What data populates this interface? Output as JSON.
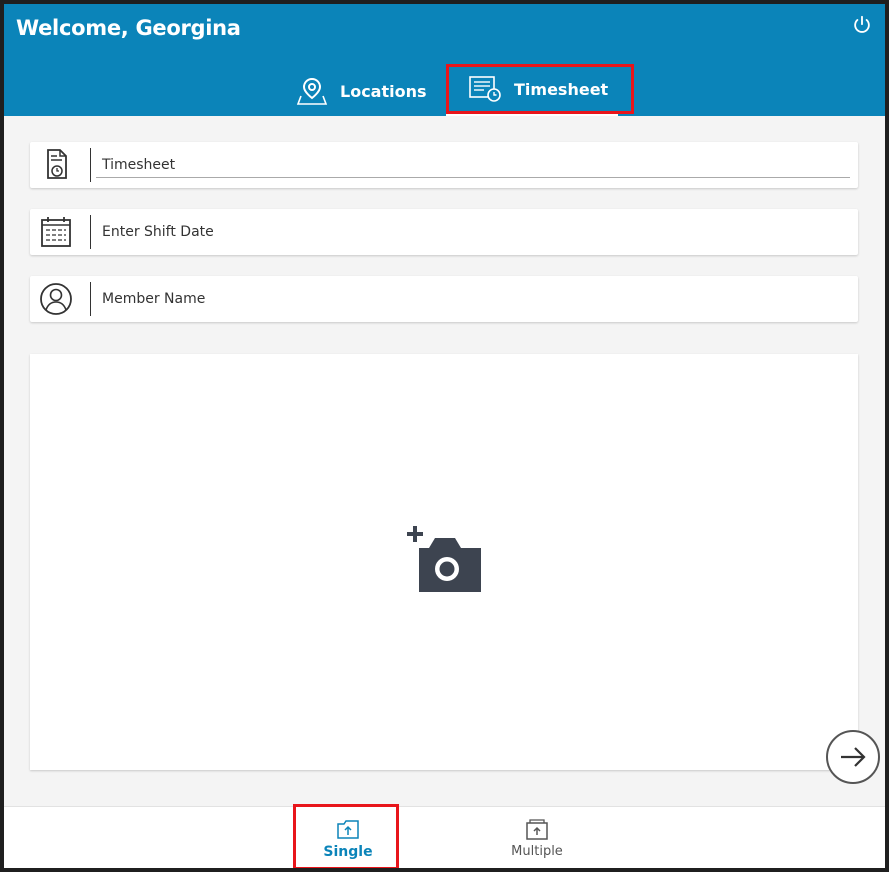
{
  "header": {
    "welcome": "Welcome, Georgina",
    "power_icon": "power-icon",
    "tabs": [
      {
        "label": "Locations",
        "icon": "map-pin-icon",
        "active": false
      },
      {
        "label": "Timesheet",
        "icon": "timesheet-icon",
        "active": true
      }
    ]
  },
  "form": {
    "timesheet": {
      "placeholder": "Timesheet",
      "icon": "document-clock-icon"
    },
    "shift_date": {
      "placeholder": "Enter Shift Date",
      "icon": "calendar-icon"
    },
    "member_name": {
      "placeholder": "Member Name",
      "icon": "user-circle-icon"
    }
  },
  "photo": {
    "icon": "add-photo-icon"
  },
  "next": {
    "icon": "arrow-right-icon"
  },
  "bottom": {
    "tabs": [
      {
        "label": "Single",
        "icon": "single-upload-icon",
        "active": true
      },
      {
        "label": "Multiple",
        "icon": "multiple-upload-icon",
        "active": false
      }
    ]
  },
  "colors": {
    "header": "#0b84b9",
    "highlight": "#e8151b",
    "active_tab": "#0b84b9"
  }
}
